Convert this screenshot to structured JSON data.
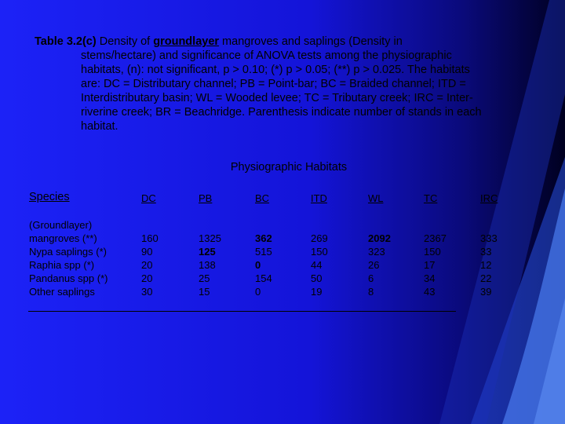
{
  "caption": {
    "label": "Table 3.2(c)",
    "pre": " Density of ",
    "emph": "groundlayer",
    "post": " mangroves  and saplings (Density in",
    "lines": [
      "stems/hectare) and significance of ANOVA tests among the physiographic",
      "habitats, (n): not significant, p > 0.10; (*) p > 0.05; (**) p > 0.025.  The habitats",
      "are: DC = Distributary channel; PB = Point-bar; BC = Braided channel; ITD =",
      "Interdistributary basin; WL = Wooded levee; TC = Tributary creek; IRC = Inter-",
      "riverine creek; BR = Beachridge. Parenthesis indicate number of stands in each",
      "habitat."
    ]
  },
  "table": {
    "group_heading": "Physiographic Habitats",
    "species_header": "Species",
    "columns": [
      "DC",
      "PB",
      "BC",
      "ITD",
      "WL",
      "TC",
      "IRC"
    ],
    "species": [
      "(Groundlayer)",
      "mangroves (**)",
      "Nypa saplings (*)",
      "Raphia spp (*)",
      "Pandanus spp (*)",
      "Other saplings"
    ],
    "values": [
      [
        "",
        "160",
        "90",
        "20",
        "20",
        "30"
      ],
      [
        "",
        "1325",
        "125",
        "138",
        "25",
        "15"
      ],
      [
        "",
        "362",
        "515",
        "0",
        "154",
        "0"
      ],
      [
        "",
        "269",
        "150",
        "44",
        "50",
        "19"
      ],
      [
        "",
        "2092",
        "323",
        "26",
        "6",
        "8"
      ],
      [
        "",
        "2367",
        "150",
        "17",
        "34",
        "43"
      ],
      [
        "",
        "333",
        "33",
        "12",
        "22",
        "39"
      ]
    ],
    "bold_cells": [
      [
        true,
        false,
        false,
        false,
        false,
        false
      ],
      [
        true,
        false,
        true,
        false,
        false,
        false
      ],
      [
        false,
        true,
        false,
        true,
        false,
        false
      ],
      [
        true,
        false,
        false,
        false,
        false,
        false
      ],
      [
        true,
        true,
        false,
        false,
        false,
        false
      ],
      [
        true,
        false,
        false,
        false,
        false,
        false
      ],
      [
        true,
        false,
        false,
        false,
        false,
        false
      ]
    ]
  },
  "colors": {
    "background_main": "#1a1ef5",
    "background_dark": "#000033",
    "accent_light": "#4a7cf0"
  }
}
